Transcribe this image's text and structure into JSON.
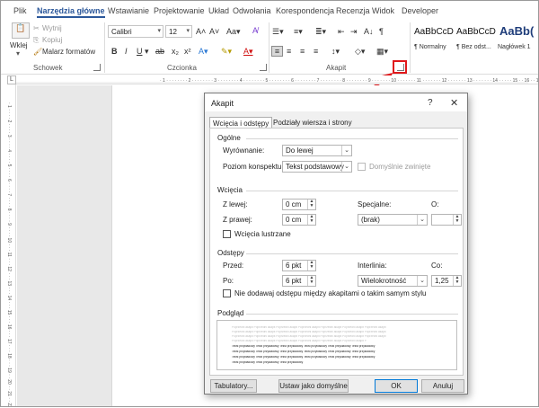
{
  "ribbon_tabs": [
    "Plik",
    "Narzędzia główne",
    "Wstawianie",
    "Projektowanie",
    "Układ",
    "Odwołania",
    "Korespondencja",
    "Recenzja",
    "Widok",
    "Developer"
  ],
  "clipboard": {
    "paste": "Wklej",
    "cut": "Wytnij",
    "copy": "Kopiuj",
    "painter": "Malarz formatów",
    "group": "Schowek"
  },
  "font": {
    "name": "Calibri",
    "size": "12",
    "group": "Czcionka"
  },
  "paragraph": {
    "group": "Akapit"
  },
  "styles": [
    {
      "preview": "AaBbCcD",
      "name": "¶ Normalny"
    },
    {
      "preview": "AaBbCcD",
      "name": "¶ Bez odst..."
    },
    {
      "preview": "AaBb(",
      "name": "Nagłówek 1"
    }
  ],
  "ruler_corner": "L",
  "dialog": {
    "title": "Akapit",
    "help": "?",
    "close": "✕",
    "tabs": [
      "Wcięcia i odstępy",
      "Podziały wiersza i strony"
    ],
    "general": {
      "heading": "Ogólne",
      "alignment_label": "Wyrównanie:",
      "alignment_value": "Do lewej",
      "outline_label": "Poziom konspektu:",
      "outline_value": "Tekst podstawowy",
      "collapsed_label": "Domyślnie zwinięte"
    },
    "indent": {
      "heading": "Wcięcia",
      "left_label": "Z lewej:",
      "left_value": "0 cm",
      "right_label": "Z prawej:",
      "right_value": "0 cm",
      "special_label": "Specjalne:",
      "special_value": "(brak)",
      "by_label": "O:",
      "by_value": "",
      "mirror_label": "Wcięcia lustrzane"
    },
    "spacing": {
      "heading": "Odstępy",
      "before_label": "Przed:",
      "before_value": "6 pkt",
      "after_label": "Po:",
      "after_value": "6 pkt",
      "line_label": "Interlinia:",
      "line_value": "Wielokrotność",
      "at_label": "Co:",
      "at_value": "1,25",
      "dont_add_label": "Nie dodawaj odstępu między akapitami o takim samym stylu"
    },
    "preview": {
      "heading": "Podgląd",
      "prev_para": "Poprzedni akapit Poprzedni akapit Poprzedni akapit Poprzedni akapit Poprzedni akapit Poprzedni akapit Poprzedni akapit",
      "sample": "Tekst przykładowy Tekst przykładowy Tekst przykładowy Tekst przykładowy Tekst przykładowy Tekst przykładowy",
      "sample_end": "Tekst przykładowy Tekst przykładowy Tekst przykładowy"
    },
    "buttons": {
      "tabs": "Tabulatory...",
      "default": "Ustaw jako domyślne",
      "ok": "OK",
      "cancel": "Anuluj"
    }
  },
  "colors": {
    "accent": "#2b579a",
    "highlight": "#e0181b"
  }
}
